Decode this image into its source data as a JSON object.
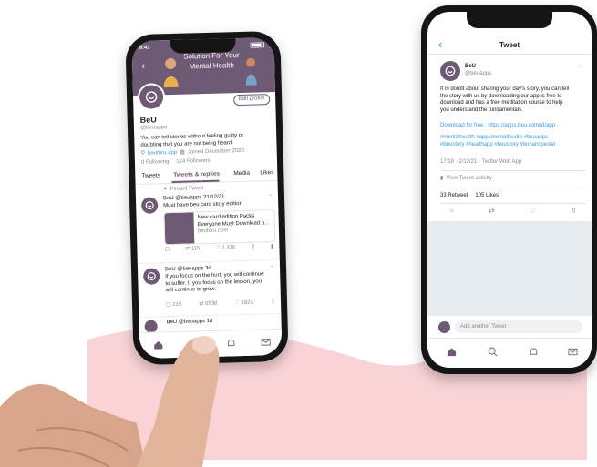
{
  "left_phone": {
    "status_time": "9:41",
    "banner_text_line1": "Solution For Your",
    "banner_text_line2": "Mental Health",
    "edit_profile": "Edit profile",
    "profile_name": "BeU",
    "profile_handle": "@beuapps",
    "bio_line1": "You can tell stories without feeling guilty or",
    "bio_line2": "doubting that you are not being heard.",
    "website": "beuforu.app",
    "joined": "Joined December 2020",
    "following": "0 Following",
    "followers": "124 Followers",
    "tabs": [
      "Tweets",
      "Tweets & replies",
      "Media",
      "Likes"
    ],
    "pinned_label": "Pinned Tweet",
    "tweets": [
      {
        "header": "BeU @beuapps 21/12/21",
        "text_line1": "Must have beu card story edition",
        "card_title_line1": "New card edition Packs",
        "card_title_line2": "Everyone Must Download o...",
        "card_domain": "beuforu.com",
        "stats": [
          "",
          "115",
          "2,336",
          ""
        ]
      },
      {
        "header": "BeU @beuapps 3d",
        "text_line1": "If you focus on the hurt, you will continue",
        "text_line2": "to suffer. If you focus on the lesson, you",
        "text_line3": "will continue to grow.",
        "stats": [
          "215",
          "6538",
          "1824",
          ""
        ]
      },
      {
        "header": "BeU @beuapps 1d"
      }
    ],
    "tabbar_icons": [
      "home-icon",
      "search-icon",
      "bell-icon",
      "mail-icon"
    ]
  },
  "right_phone": {
    "back_label": "‹",
    "title": "Tweet",
    "name": "BeU",
    "handle": "@beuapps",
    "body_line1": "If in doubt about sharing your day's story, you can tell",
    "body_line2": "the story with us by downloading our app is free to",
    "body_line3": "download and has a free meditation course to help",
    "body_line4": "you understand the fundamentals.",
    "download_line": "Download for free : https://apps.beu.com/id/app",
    "hashtags_line1": "#mentalhealth #appsmentalhealth #beuapps",
    "hashtags_line2": "#beustory #healthapp #beustory #temanspesial",
    "meta_line": "17:18 · 2/12/21 · Twitter Web App",
    "activity": "View Tweet activity",
    "retweets": "33 Retweet",
    "likes": "105 Likes",
    "reply_placeholder": "Add another Tweet",
    "tabbar_icons": [
      "home-icon",
      "search-icon",
      "bell-icon",
      "mail-icon"
    ]
  },
  "colors": {
    "brand_purple": "#6f5a76",
    "link_blue": "#3a9be0",
    "pink_background": "#f9d3d6"
  }
}
